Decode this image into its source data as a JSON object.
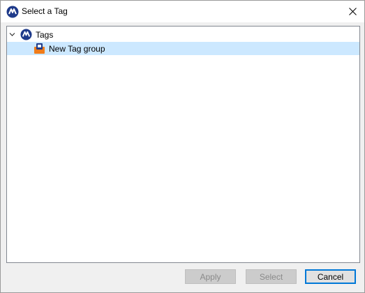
{
  "window": {
    "title": "Select a Tag",
    "app_icon": "tags-logo-icon",
    "close_icon": "close-icon"
  },
  "tree": {
    "root": {
      "label": "Tags",
      "icon": "tags-logo-icon",
      "expanded": true
    },
    "children": [
      {
        "label": "New Tag group",
        "icon": "tag-group-icon",
        "selected": true
      }
    ]
  },
  "buttons": {
    "apply": {
      "label": "Apply",
      "enabled": false
    },
    "select": {
      "label": "Select",
      "enabled": false
    },
    "cancel": {
      "label": "Cancel",
      "enabled": true
    }
  },
  "colors": {
    "selection": "#cce8ff",
    "logo_blue": "#1e3a8a",
    "focus_border": "#0078d7",
    "tag_group_orange": "#f07c1a"
  }
}
